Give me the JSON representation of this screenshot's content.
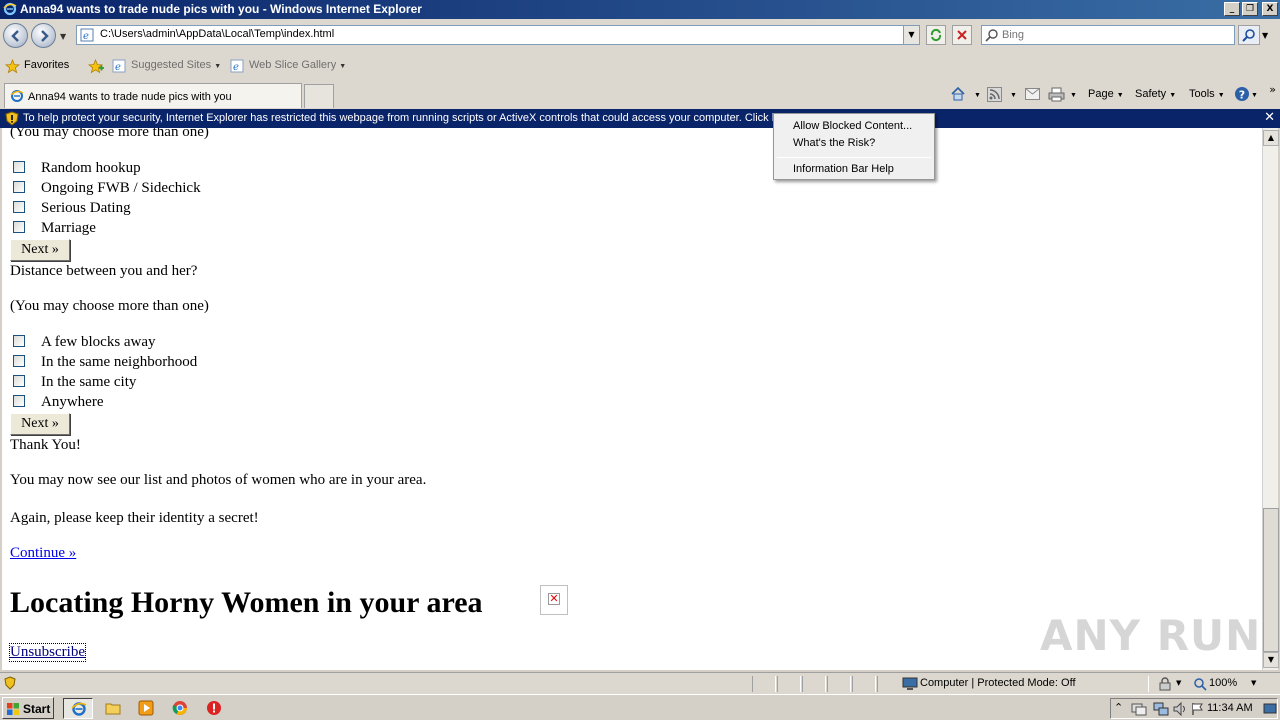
{
  "window": {
    "title": "Anna94 wants to trade nude pics with you - Windows Internet Explorer",
    "controls": {
      "minimize": "_",
      "maximize": "❐",
      "close": "X"
    }
  },
  "nav": {
    "address": "C:\\Users\\admin\\AppData\\Local\\Temp\\index.html",
    "search_placeholder": "Bing"
  },
  "favorites": {
    "favorites_label": "Favorites",
    "suggested_sites": "Suggested Sites",
    "web_slice_gallery": "Web Slice Gallery"
  },
  "tabs": {
    "active_tab": "Anna94 wants to trade nude pics with you"
  },
  "commandbar": {
    "page": "Page",
    "safety": "Safety",
    "tools": "Tools"
  },
  "infobar": {
    "message": "To help protect your security, Internet Explorer has restricted this webpage from running scripts or ActiveX controls that could access your computer. Click here for options..."
  },
  "context_menu": {
    "items": [
      "Allow Blocked Content...",
      "What's the Risk?",
      "Information Bar Help"
    ]
  },
  "page": {
    "choose_more_top": "(You may choose more than one)",
    "relationship_options": [
      "Random hookup",
      "Ongoing FWB / Sidechick",
      "Serious Dating",
      "Marriage"
    ],
    "next_label": "Next »",
    "distance_question": "Distance between you and her?",
    "choose_more": "(You may choose more than one)",
    "distance_options": [
      "A few blocks away",
      "In the same neighborhood",
      "In the same city",
      "Anywhere"
    ],
    "thank_you": "Thank You!",
    "see_list": "You may now see our list and photos of women who are in your area.",
    "secret": "Again, please keep their identity a secret!",
    "continue_link": "Continue »",
    "heading": "Locating Horny Women in your area",
    "unsubscribe": "Unsubscribe",
    "watermark": "ANY RUN"
  },
  "statusbar": {
    "zone": "Computer | Protected Mode: Off",
    "zoom": "100%"
  },
  "taskbar": {
    "start_label": "Start",
    "clock": "11:34 AM"
  },
  "colors": {
    "infobar_bg": "#0a246a",
    "link": "#0000ee",
    "chrome": "#dcd8cf"
  }
}
